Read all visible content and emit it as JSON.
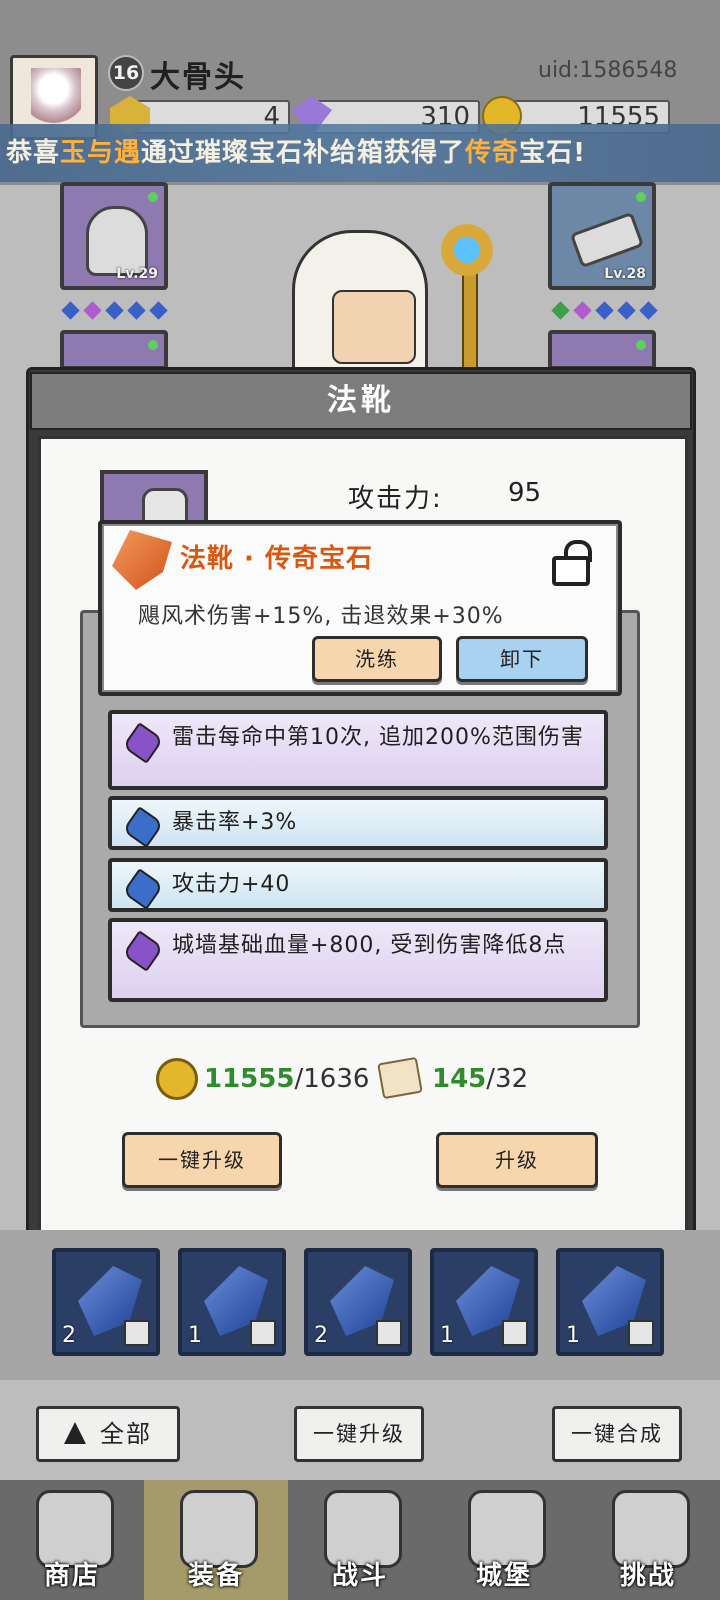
{
  "player": {
    "name": "大骨头",
    "level": "16",
    "uid": "uid:1586548"
  },
  "resources": [
    {
      "icon": "gold-gem-icon",
      "value": "4"
    },
    {
      "icon": "purple-diamond-icon",
      "value": "310"
    },
    {
      "icon": "coin-icon",
      "value": "11555"
    }
  ],
  "banner": {
    "prefix": "恭喜",
    "player": "玉与遇",
    "mid": "通过璀璨宝石补给箱获得了",
    "rarity": "传奇",
    "suffix": "宝石!"
  },
  "equipment": {
    "left_top_level": "Lv.29",
    "right_top_level": "Lv.28"
  },
  "dialog": {
    "title": "法靴",
    "attack_label": "攻击力:",
    "attack_value": "95"
  },
  "popup": {
    "title": "法靴 · 传奇宝石",
    "description": "飓风术伤害+15%, 击退效果+30%",
    "refine_label": "洗练",
    "unequip_label": "卸下",
    "lock_icon": "unlocked-padlock-icon"
  },
  "gem_rows": [
    {
      "text": "雷击每命中第10次, 追加200%范围伤害",
      "color": "purple"
    },
    {
      "text": "暴击率+3%",
      "color": "blue"
    },
    {
      "text": "攻击力+40",
      "color": "blue"
    },
    {
      "text": "城墙基础血量+800, 受到伤害降低8点",
      "color": "purple"
    }
  ],
  "costs": {
    "coin_have": "11555",
    "coin_need": "/1636",
    "scroll_have": "145",
    "scroll_need": "/32"
  },
  "dialog_buttons": {
    "quick_upgrade": "一键升级",
    "upgrade": "升级"
  },
  "inventory": [
    {
      "count": "2",
      "type_icon": "armor-icon"
    },
    {
      "count": "1",
      "type_icon": "boot-icon"
    },
    {
      "count": "2",
      "type_icon": "staff-icon"
    },
    {
      "count": "1",
      "type_icon": "staff-icon"
    },
    {
      "count": "1",
      "type_icon": "staff-icon"
    }
  ],
  "actions": {
    "all": "全部",
    "quick_upgrade": "一键升级",
    "quick_merge": "一键合成"
  },
  "nav": [
    {
      "label": "商店",
      "active": false
    },
    {
      "label": "装备",
      "active": true
    },
    {
      "label": "战斗",
      "active": false
    },
    {
      "label": "城堡",
      "active": false
    },
    {
      "label": "挑战",
      "active": false
    }
  ],
  "colors": {
    "legendary": "#d85812",
    "banner_highlight": "#ffb13b",
    "have_amount": "#2e8c2c",
    "nav_active": "#a59a6a"
  }
}
